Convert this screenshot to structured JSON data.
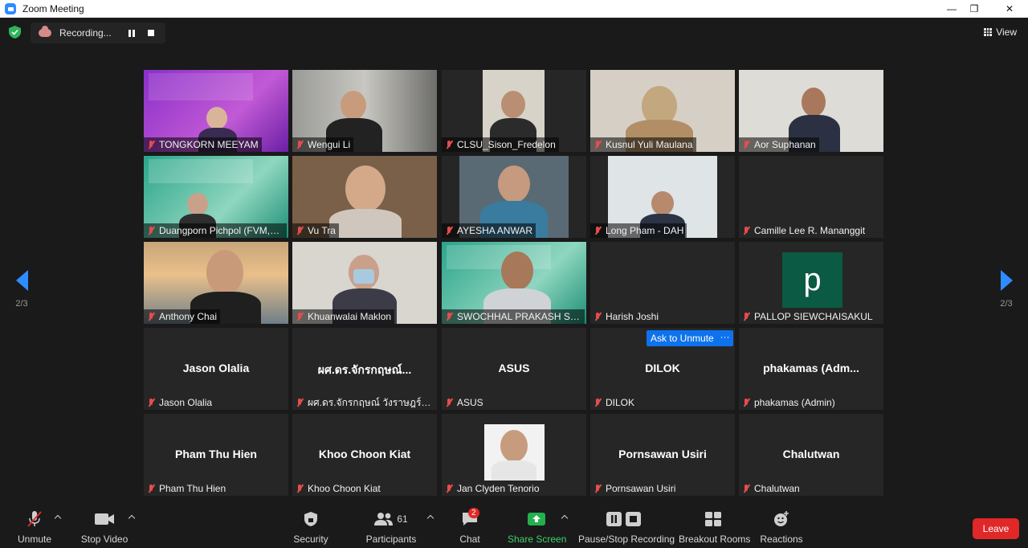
{
  "window": {
    "title": "Zoom Meeting",
    "minimize_icon": "minimize-icon",
    "maximize_icon": "maximize-icon",
    "close_icon": "close-icon"
  },
  "topbar": {
    "recording_label": "Recording...",
    "view_label": "View"
  },
  "pager": {
    "left_page": "2/3",
    "right_page": "2/3"
  },
  "tiles": [
    {
      "name": "TONGKORN MEEYAM"
    },
    {
      "name": "Wengui Li"
    },
    {
      "name": "CLSU_Sison_Fredelon"
    },
    {
      "name": "Kusnul Yuli Maulana"
    },
    {
      "name": "Aor Suphanan"
    },
    {
      "name": "Duangporn Pichpol (FVM,C..."
    },
    {
      "name": "Vu Tra"
    },
    {
      "name": "AYESHA  ANWAR"
    },
    {
      "name": "Long Pham - DAH"
    },
    {
      "name": "Camille Lee R. Mananggit"
    },
    {
      "name": "Anthony Chai"
    },
    {
      "name": "Khuanwalai Maklon"
    },
    {
      "name": "SWOCHHAL PRAKASH SHR..."
    },
    {
      "name": "Harish Joshi"
    },
    {
      "name": "PALLOP SIEWCHAISAKUL",
      "avatar_letter": "p"
    },
    {
      "name": "Jason Olalia",
      "display": "Jason Olalia"
    },
    {
      "name": "ผศ.ดร.จักรกฤษณ์ วังราษฎร์ สา...",
      "display": "ผศ.ดร.จักรกฤษณ์..."
    },
    {
      "name": "ASUS",
      "display": "ASUS"
    },
    {
      "name": "DILOK",
      "display": "DILOK"
    },
    {
      "name": "phakamas (Admin)",
      "display": "phakamas  (Adm..."
    },
    {
      "name": "Pham Thu Hien",
      "display": "Pham Thu Hien"
    },
    {
      "name": "Khoo Choon Kiat",
      "display": "Khoo Choon Kiat"
    },
    {
      "name": "Jan Clyden Tenorio"
    },
    {
      "name": "Pornsawan Usiri",
      "display": "Pornsawan Usiri"
    },
    {
      "name": "Chalutwan",
      "display": "Chalutwan"
    }
  ],
  "unmute": {
    "ask_label": "Ask to Unmute",
    "more_label": "···"
  },
  "toolbar": {
    "unmute": "Unmute",
    "stop_video": "Stop Video",
    "security": "Security",
    "participants": "Participants",
    "participants_count": "61",
    "chat": "Chat",
    "chat_badge": "2",
    "share_screen": "Share Screen",
    "pause_stop_recording": "Pause/Stop Recording",
    "breakout_rooms": "Breakout Rooms",
    "reactions": "Reactions",
    "leave": "Leave"
  },
  "colors": {
    "accent": "#2D8CFF",
    "share_green": "#22b14c",
    "leave_red": "#e02828",
    "muted_red": "#e74c4c"
  }
}
